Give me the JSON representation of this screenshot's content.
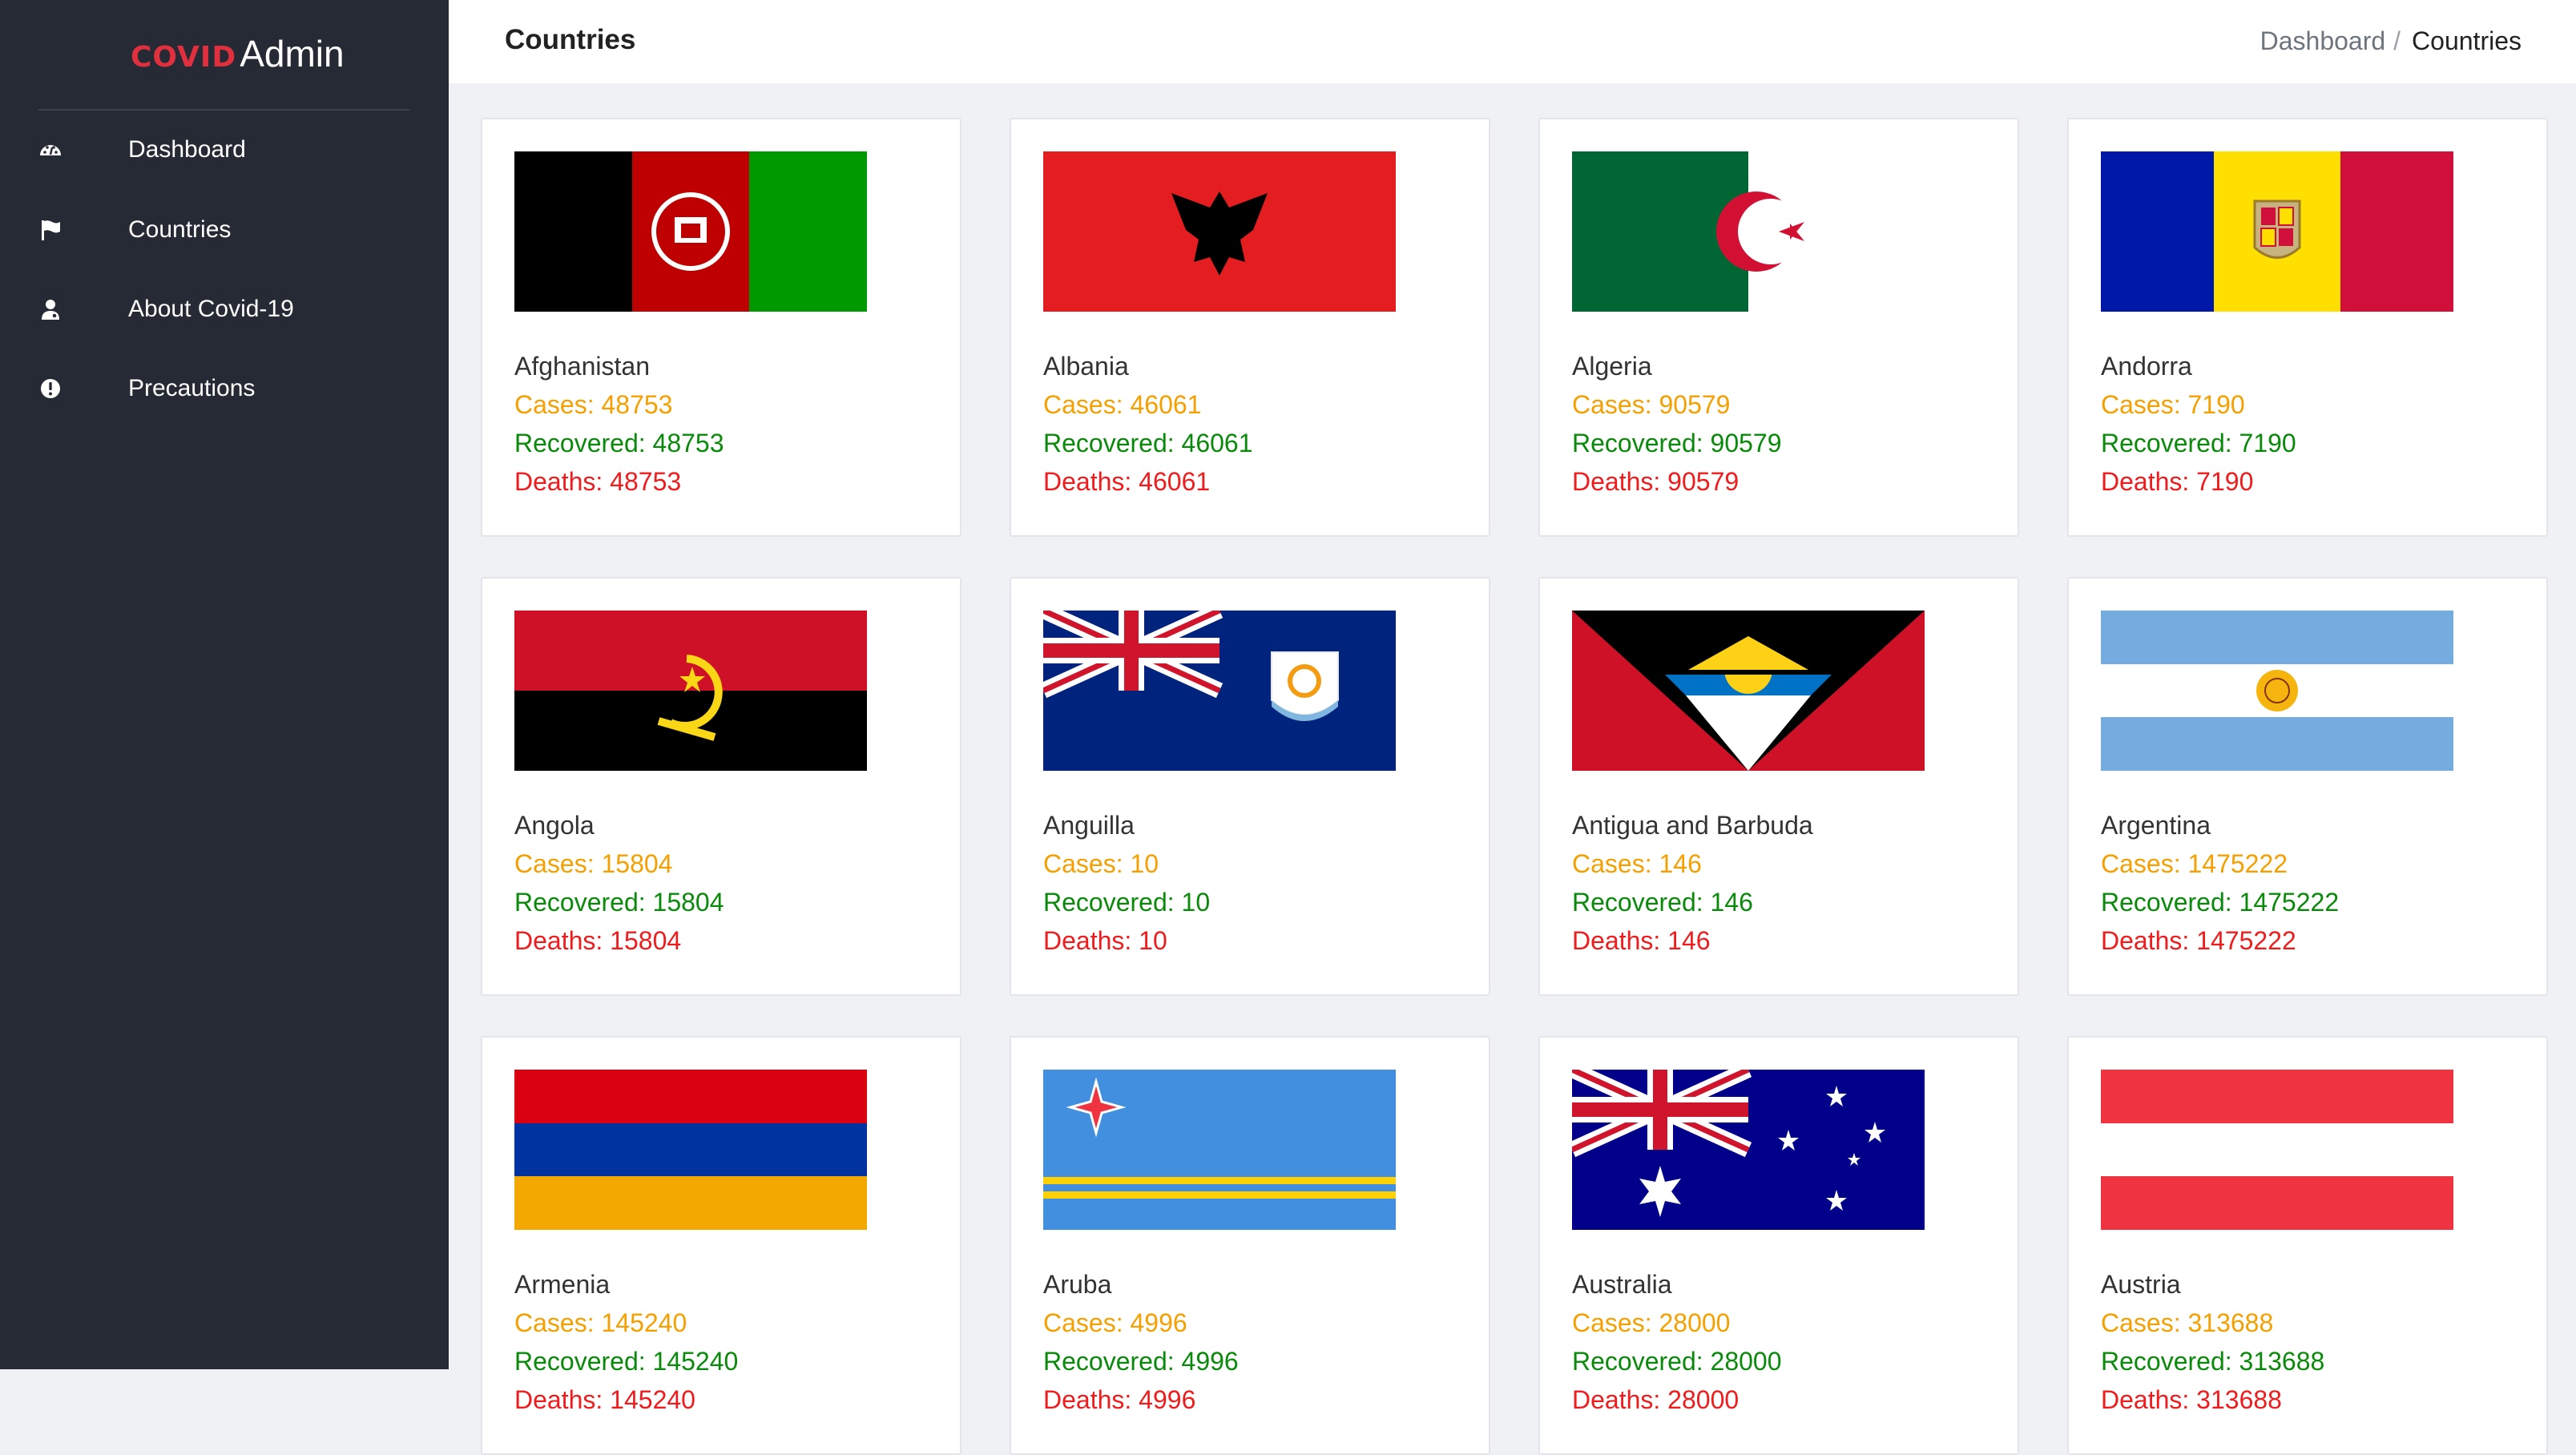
{
  "brand": {
    "prefix": "COVID",
    "suffix": "Admin"
  },
  "sidebar": {
    "items": [
      {
        "label": "Dashboard",
        "icon": "dashboard-icon"
      },
      {
        "label": "Countries",
        "icon": "flag-icon"
      },
      {
        "label": "About Covid-19",
        "icon": "user-doctor-icon"
      },
      {
        "label": "Precautions",
        "icon": "exclamation-circle-icon"
      }
    ]
  },
  "header": {
    "title": "Countries",
    "breadcrumb": {
      "home": "Dashboard",
      "separator": "/",
      "current": "Countries"
    }
  },
  "countries": [
    {
      "name": "Afghanistan",
      "cases": "Cases: 48753",
      "recovered": "Recovered: 48753",
      "deaths": "Deaths: 48753"
    },
    {
      "name": "Albania",
      "cases": "Cases: 46061",
      "recovered": "Recovered: 46061",
      "deaths": "Deaths: 46061"
    },
    {
      "name": "Algeria",
      "cases": "Cases: 90579",
      "recovered": "Recovered: 90579",
      "deaths": "Deaths: 90579"
    },
    {
      "name": "Andorra",
      "cases": "Cases: 7190",
      "recovered": "Recovered: 7190",
      "deaths": "Deaths: 7190"
    },
    {
      "name": "Angola",
      "cases": "Cases: 15804",
      "recovered": "Recovered: 15804",
      "deaths": "Deaths: 15804"
    },
    {
      "name": "Anguilla",
      "cases": "Cases: 10",
      "recovered": "Recovered: 10",
      "deaths": "Deaths: 10"
    },
    {
      "name": "Antigua and Barbuda",
      "cases": "Cases: 146",
      "recovered": "Recovered: 146",
      "deaths": "Deaths: 146"
    },
    {
      "name": "Argentina",
      "cases": "Cases: 1475222",
      "recovered": "Recovered: 1475222",
      "deaths": "Deaths: 1475222"
    },
    {
      "name": "Armenia",
      "cases": "Cases: 145240",
      "recovered": "Recovered: 145240",
      "deaths": "Deaths: 145240"
    },
    {
      "name": "Aruba",
      "cases": "Cases: 4996",
      "recovered": "Recovered: 4996",
      "deaths": "Deaths: 4996"
    },
    {
      "name": "Australia",
      "cases": "Cases: 28000",
      "recovered": "Recovered: 28000",
      "deaths": "Deaths: 28000"
    },
    {
      "name": "Austria",
      "cases": "Cases: 313688",
      "recovered": "Recovered: 313688",
      "deaths": "Deaths: 313688"
    }
  ],
  "colors": {
    "sidebar_bg": "#262a35",
    "brand_red": "#e0303d",
    "cases": "#f5a000",
    "recovered": "#0a8a0a",
    "deaths": "#ee1c1c"
  }
}
